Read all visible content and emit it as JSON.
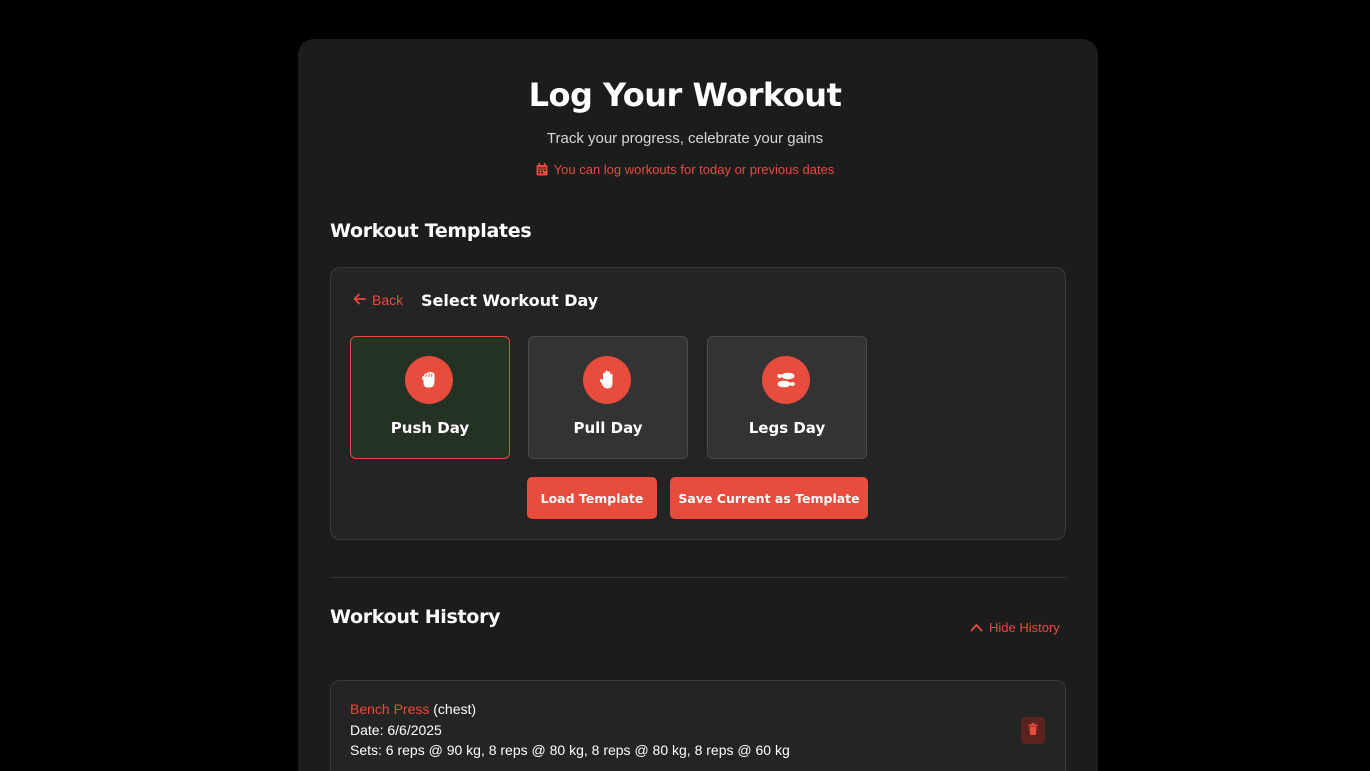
{
  "header": {
    "title": "Log Your Workout",
    "subtitle": "Track your progress, celebrate your gains",
    "notice": "You can log workouts for today or previous dates",
    "notice_icon": "calendar-icon"
  },
  "templates": {
    "section_title": "Workout Templates",
    "back_label": "Back",
    "panel_heading": "Select Workout Day",
    "days": [
      {
        "label": "Push Day",
        "icon": "fist-icon",
        "selected": true
      },
      {
        "label": "Pull Day",
        "icon": "hand-icon",
        "selected": false
      },
      {
        "label": "Legs Day",
        "icon": "footprints-icon",
        "selected": false
      }
    ],
    "load_button": "Load Template",
    "save_button": "Save Current as Template"
  },
  "history": {
    "section_title": "Workout History",
    "toggle_label": "Hide History",
    "entries": [
      {
        "exercise": "Bench Press",
        "category": "(chest)",
        "date": "Date: 6/6/2025",
        "sets": "Sets: 6 reps @ 90 kg, 8 reps @ 80 kg, 8 reps @ 80 kg, 8 reps @ 60 kg"
      }
    ]
  },
  "colors": {
    "accent": "#e74c3c",
    "background": "#000000",
    "card": "#1c1c1c",
    "panel": "#242424",
    "selected_day": "#233223"
  }
}
